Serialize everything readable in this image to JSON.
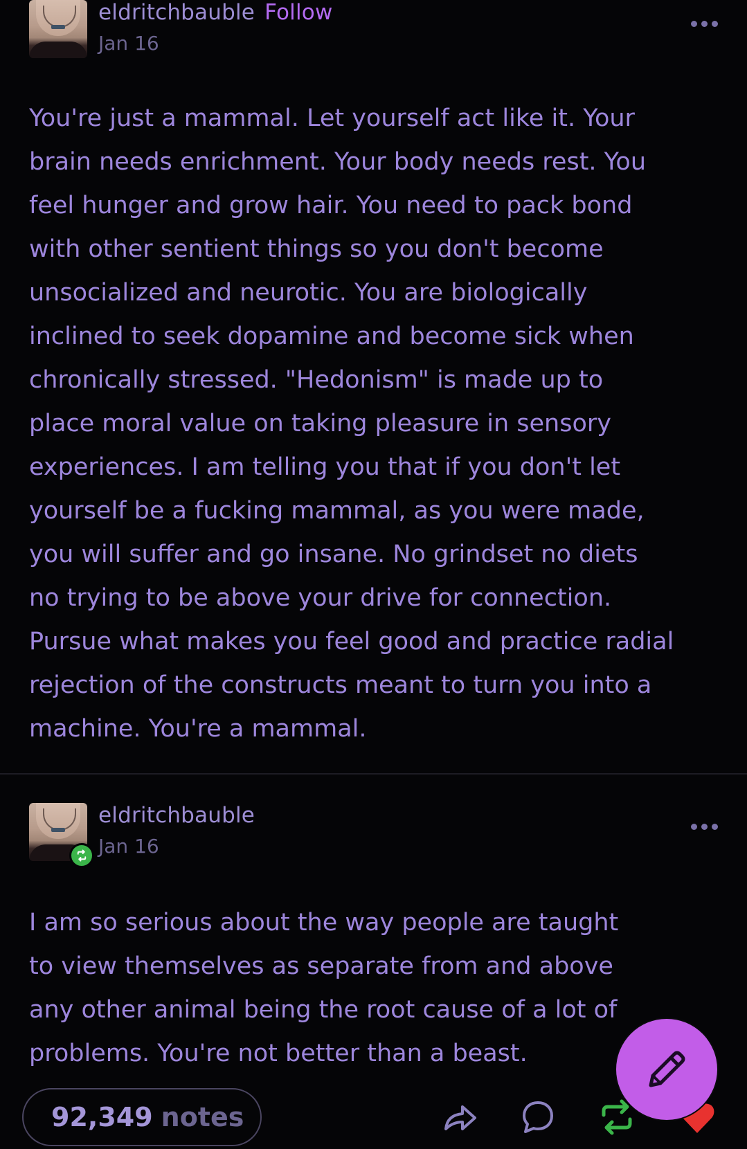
{
  "posts": [
    {
      "username": "eldritchbauble",
      "follow_label": "Follow",
      "date": "Jan 16",
      "body": "You're just a mammal. Let yourself act like it. Your\nbrain needs enrichment. Your body needs rest. You\nfeel hunger and grow hair. You need to pack bond\nwith other sentient things so you don't become\nunsocialized and neurotic. You are biologically\ninclined to seek dopamine and become sick when\nchronically stressed. \"Hedonism\" is made up to\nplace moral value on taking pleasure in sensory\nexperiences. I am telling you that if you don't let\nyourself be a fucking mammal, as you were made,\nyou will suffer and go insane. No grindset no diets\nno trying to be above your drive for connection.\nPursue what makes you feel good and practice radial\nrejection of the constructs meant to turn you into a\nmachine. You're a mammal."
    },
    {
      "username": "eldritchbauble",
      "date": "Jan 16",
      "body": "I am so serious about the way people are taught\nto view themselves as separate from and above\nany other animal being the root cause of a lot of\nproblems. You're not better than a beast."
    }
  ],
  "footer": {
    "notes_count": "92,349",
    "notes_label": "notes"
  },
  "icons": {
    "more": "more-horizontal-icon",
    "share": "share-icon",
    "reply": "reply-icon",
    "reblog": "reblog-icon",
    "like": "heart-icon",
    "compose": "pencil-icon"
  },
  "colors": {
    "background": "#050507",
    "text": "#9d86dc",
    "accent_follow": "#b46bf2",
    "reblog_green": "#3bb54a",
    "like_red": "#e8322f",
    "fab": "#c25de8"
  }
}
